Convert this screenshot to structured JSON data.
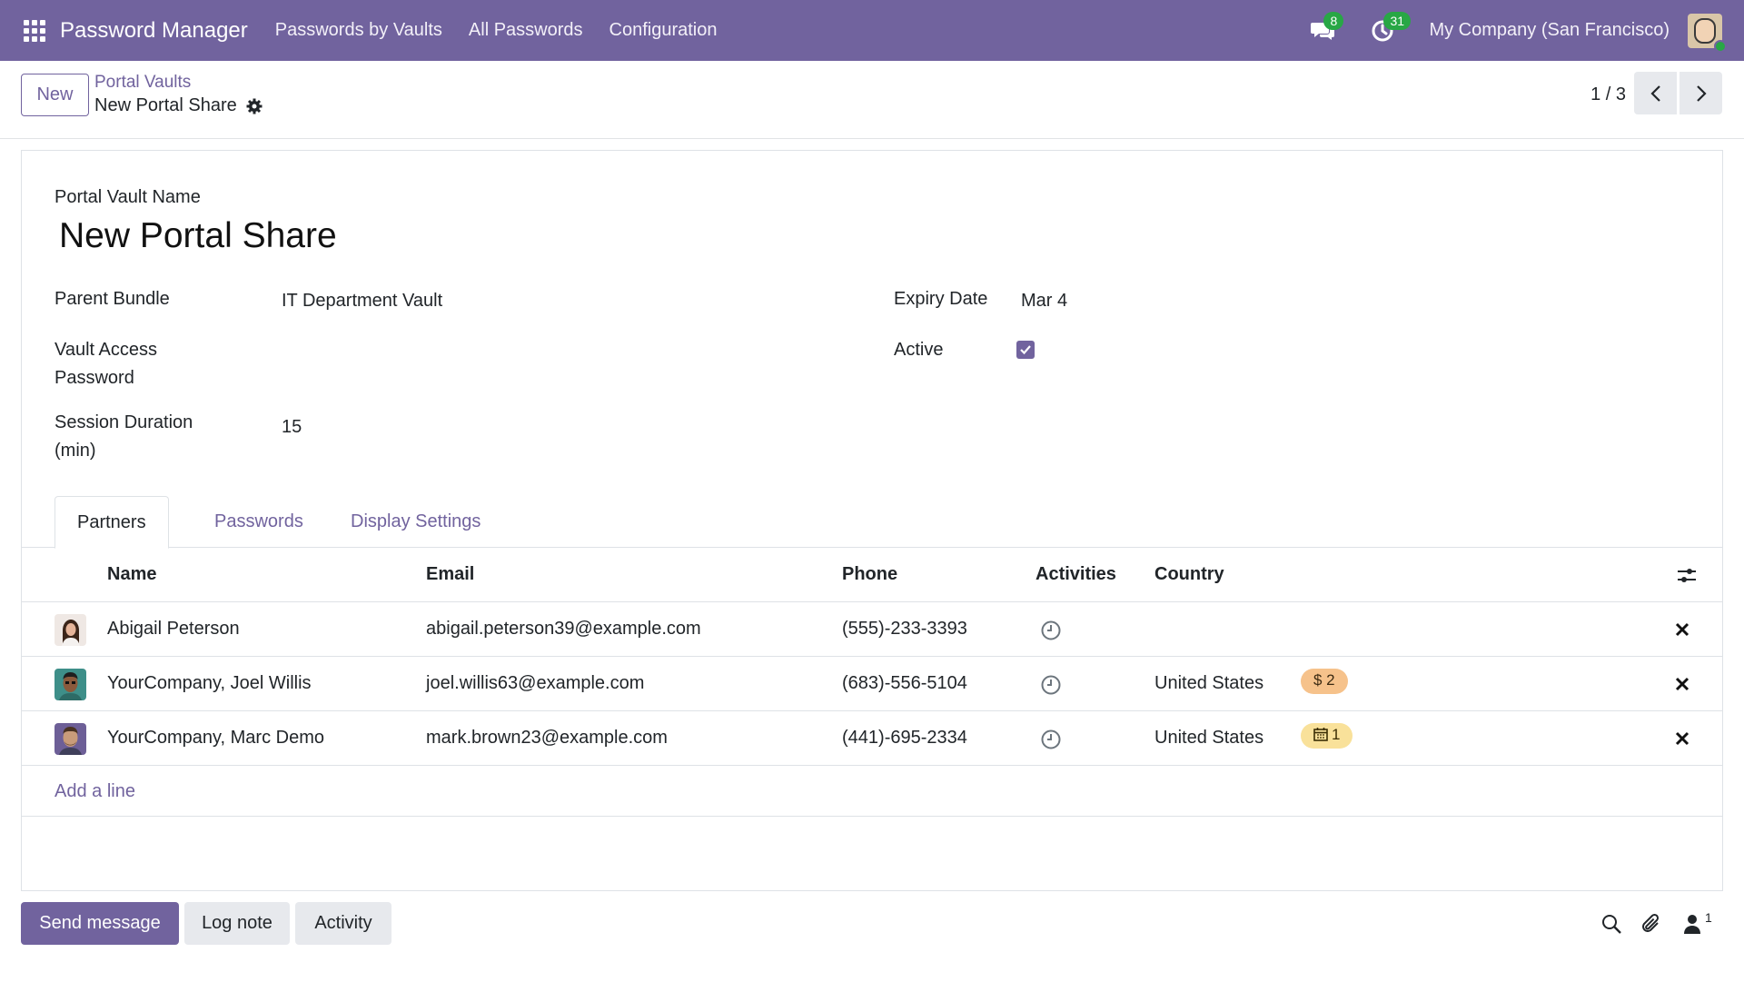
{
  "navbar": {
    "app_title": "Password Manager",
    "menu": [
      "Passwords by Vaults",
      "All Passwords",
      "Configuration"
    ],
    "messages_count": "8",
    "activities_count": "31",
    "company": "My Company (San Francisco)"
  },
  "control_panel": {
    "new_label": "New",
    "breadcrumb_parent": "Portal Vaults",
    "breadcrumb_current": "New Portal Share",
    "pager": "1 / 3"
  },
  "form": {
    "name_label": "Portal Vault Name",
    "name_value": "New Portal Share",
    "parent_bundle_label": "Parent Bundle",
    "parent_bundle_value": "IT Department Vault",
    "vault_password_label_1": "Vault Access",
    "vault_password_label_2": "Password",
    "session_label_1": "Session Duration",
    "session_label_2": "(min)",
    "session_value": "15",
    "expiry_label": "Expiry Date",
    "expiry_value": "Mar 4",
    "active_label": "Active",
    "active_value": true
  },
  "tabs": [
    "Partners",
    "Passwords",
    "Display Settings"
  ],
  "table": {
    "columns": [
      "Name",
      "Email",
      "Phone",
      "Activities",
      "Country"
    ],
    "rows": [
      {
        "name": "Abigail Peterson",
        "email": "abigail.peterson39@example.com",
        "phone": "(555)-233-3393",
        "country": "",
        "tag": ""
      },
      {
        "name": "YourCompany, Joel Willis",
        "email": "joel.willis63@example.com",
        "phone": "(683)-556-5104",
        "country": "United States",
        "tag": "$ 2"
      },
      {
        "name": "YourCompany, Marc Demo",
        "email": "mark.brown23@example.com",
        "phone": "(441)-695-2334",
        "country": "United States",
        "tag": "1"
      }
    ],
    "add_line": "Add a line"
  },
  "chatter": {
    "send_message": "Send message",
    "log_note": "Log note",
    "activity": "Activity",
    "followers_count": "1"
  },
  "colors": {
    "brand": "#71639e",
    "badge_green": "#28a745",
    "tag_orange": "#f6c28b",
    "tag_yellow": "#f9e19a"
  }
}
